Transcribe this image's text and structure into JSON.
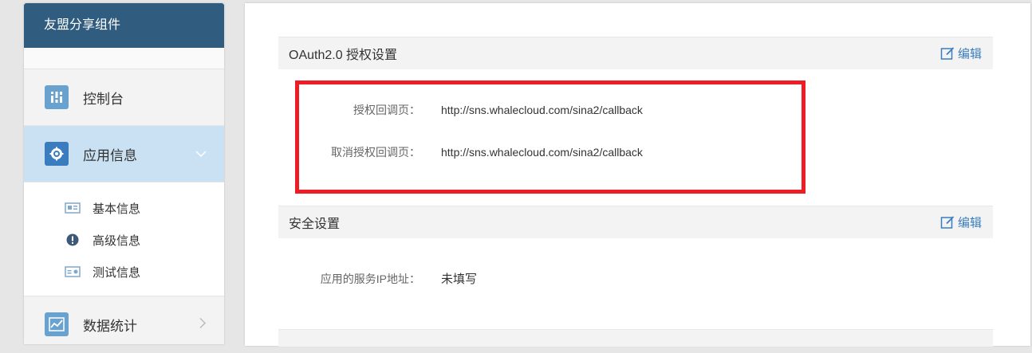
{
  "sidebar": {
    "title": "友盟分享组件",
    "items": [
      {
        "label": "控制台",
        "icon": "dashboard-icon"
      },
      {
        "label": "应用信息",
        "icon": "gear-icon",
        "active": true,
        "subitems": [
          {
            "label": "基本信息",
            "icon": "card-icon"
          },
          {
            "label": "高级信息",
            "icon": "alert-icon"
          },
          {
            "label": "测试信息",
            "icon": "id-card-icon"
          }
        ]
      },
      {
        "label": "数据统计",
        "icon": "chart-icon"
      }
    ]
  },
  "main": {
    "oauth": {
      "title": "OAuth2.0 授权设置",
      "edit_label": "编辑",
      "fields": [
        {
          "label": "授权回调页：",
          "value": "http://sns.whalecloud.com/sina2/callback"
        },
        {
          "label": "取消授权回调页：",
          "value": "http://sns.whalecloud.com/sina2/callback"
        }
      ]
    },
    "security": {
      "title": "安全设置",
      "edit_label": "编辑",
      "fields": [
        {
          "label": "应用的服务IP地址：",
          "value": "未填写"
        }
      ]
    }
  },
  "colors": {
    "sidebar_header": "#2f5c7f",
    "active_item_bg": "#c9e1f2",
    "icon_blue": "#6aa2cf",
    "link_blue": "#3a7dbf",
    "highlight_red": "#ee1c25"
  }
}
